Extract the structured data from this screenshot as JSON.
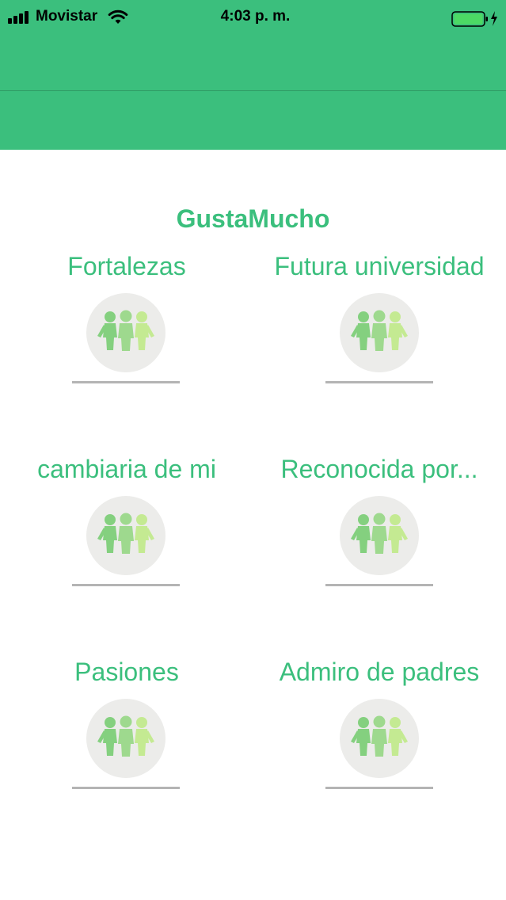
{
  "status_bar": {
    "carrier": "Movistar",
    "time": "4:03 p. m.",
    "signal_bars": 4,
    "wifi_icon": "wifi-icon",
    "battery_icon": "battery-charging-icon",
    "battery_level": 1.0
  },
  "colors": {
    "brand_green": "#3bbf7d",
    "avatar_bg": "#ececea",
    "underline": "#b4b4b4"
  },
  "page": {
    "title": "GustaMucho"
  },
  "tiles": [
    {
      "label": "Fortalezas",
      "icon": "people-group-icon"
    },
    {
      "label": "Futura universidad",
      "icon": "people-group-icon"
    },
    {
      "label": "cambiaria de mi",
      "icon": "people-group-icon"
    },
    {
      "label": "Reconocida por...",
      "icon": "people-group-icon"
    },
    {
      "label": "Pasiones",
      "icon": "people-group-icon"
    },
    {
      "label": "Admiro de padres",
      "icon": "people-group-icon"
    }
  ]
}
